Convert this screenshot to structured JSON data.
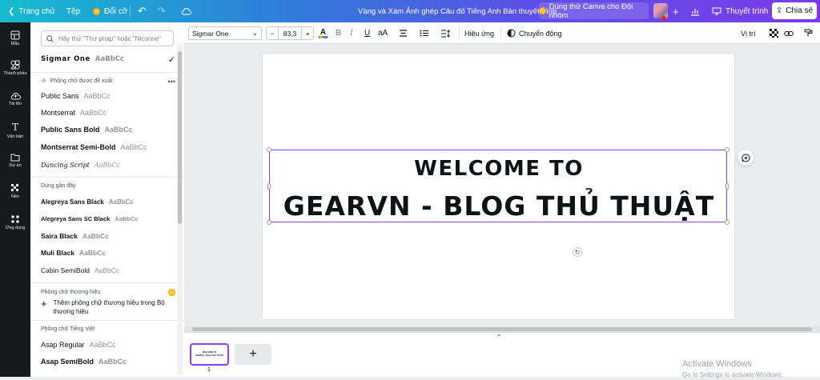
{
  "topbar": {
    "home": "Trang chủ",
    "file": "Tệp",
    "change": "Đổi cỡ",
    "design_title": "Vàng và Xám Ảnh ghép Câu đố Tiếng Anh Bản thuyết trình",
    "try_canva": "Dùng thử Canva cho Đội nhóm",
    "present": "Thuyết trình",
    "share": "Chia sẻ"
  },
  "rail": [
    {
      "label": "Mẫu",
      "icon": "grid-icon"
    },
    {
      "label": "Thành phần",
      "icon": "shapes-icon"
    },
    {
      "label": "Tải lên",
      "icon": "upload-icon"
    },
    {
      "label": "Văn bản",
      "icon": "text-icon"
    },
    {
      "label": "Dự án",
      "icon": "folder-icon"
    },
    {
      "label": "Nền",
      "icon": "background-icon"
    },
    {
      "label": "Ứng dụng",
      "icon": "apps-icon"
    }
  ],
  "panel": {
    "search_placeholder": "Hãy thử \"Thư pháp\" hoặc \"Niconne\"",
    "current_font": "Sigmar One",
    "current_sample": "AaBbCc",
    "suggested_title": "Phông chữ được đề xuất",
    "suggested": [
      {
        "name": "Public Sans",
        "sample": "AaBbCc"
      },
      {
        "name": "Montserrat",
        "sample": "AaBbCc"
      },
      {
        "name": "Public Sans Bold",
        "sample": "AaBbCc"
      },
      {
        "name": "Montserrat Semi-Bold",
        "sample": "AaBbCc"
      },
      {
        "name": "Dancing Script",
        "sample": "AaBbCc"
      }
    ],
    "recent_title": "Dùng gần đây",
    "recent": [
      {
        "name": "Alegreya Sans Black",
        "sample": "AaBbCc"
      },
      {
        "name": "Alegreya Sans SC Black",
        "sample": "AaBbCc"
      },
      {
        "name": "Saira Black",
        "sample": "AaBbCc"
      },
      {
        "name": "Muli Black",
        "sample": "AaBbCc"
      },
      {
        "name": "Cabin SemiBold",
        "sample": "AaBbCc"
      }
    ],
    "brand_title": "Phông chữ thương hiệu",
    "brand_add": "Thêm phông chữ thương hiệu trong Bộ thương hiệu",
    "viet_title": "Phông chữ Tiếng Việt",
    "viet": [
      {
        "name": "Asap Regular",
        "sample": "AaBbCc"
      },
      {
        "name": "Asap SemiBold",
        "sample": "AaBbCc"
      }
    ]
  },
  "toolbar": {
    "font": "Sigmar One",
    "size": "83,3",
    "effects": "Hiệu ứng",
    "animate": "Chuyển động",
    "position": "Vị trí"
  },
  "canvas": {
    "line1": "WELCOME TO",
    "line2": "GEARVN - BLOG THỦ THUẬT"
  },
  "pages": {
    "page_number": "1",
    "add_label": "+"
  },
  "watermark": {
    "title": "Activate Windows",
    "subtitle": "Go to Settings to activate Windows."
  },
  "colors": {
    "brand_purple": "#8b3dff",
    "rail_bg": "#18191b"
  }
}
